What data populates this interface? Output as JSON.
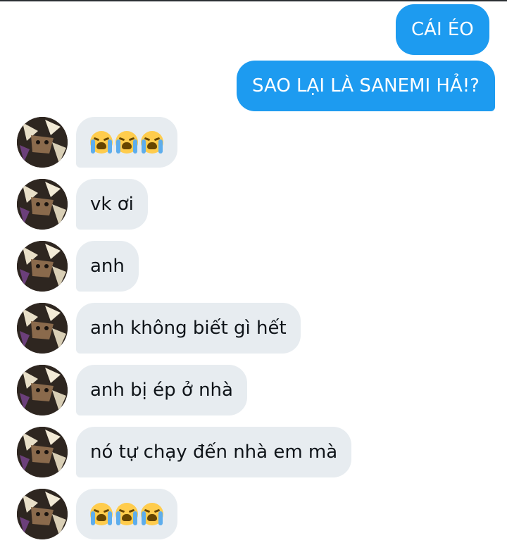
{
  "messages": [
    {
      "side": "sent",
      "text": "CÁI ÉO"
    },
    {
      "side": "sent",
      "text": "SAO LẠI LÀ SANEMI HẢ!?"
    },
    {
      "side": "received",
      "emoji": [
        "loudly-crying-face",
        "loudly-crying-face",
        "loudly-crying-face"
      ]
    },
    {
      "side": "received",
      "text": "vk ơi"
    },
    {
      "side": "received",
      "text": "anh"
    },
    {
      "side": "received",
      "text": "anh không biết gì hết"
    },
    {
      "side": "received",
      "text": "anh bị ép ở nhà"
    },
    {
      "side": "received",
      "text": "nó tự chạy đến nhà em mà"
    },
    {
      "side": "received",
      "emoji": [
        "loudly-crying-face",
        "loudly-crying-face",
        "loudly-crying-face"
      ]
    }
  ],
  "colors": {
    "sent_bubble": "#1d9bf0",
    "received_bubble": "#e7ecf0",
    "sent_text": "#ffffff",
    "received_text": "#0f1419"
  }
}
